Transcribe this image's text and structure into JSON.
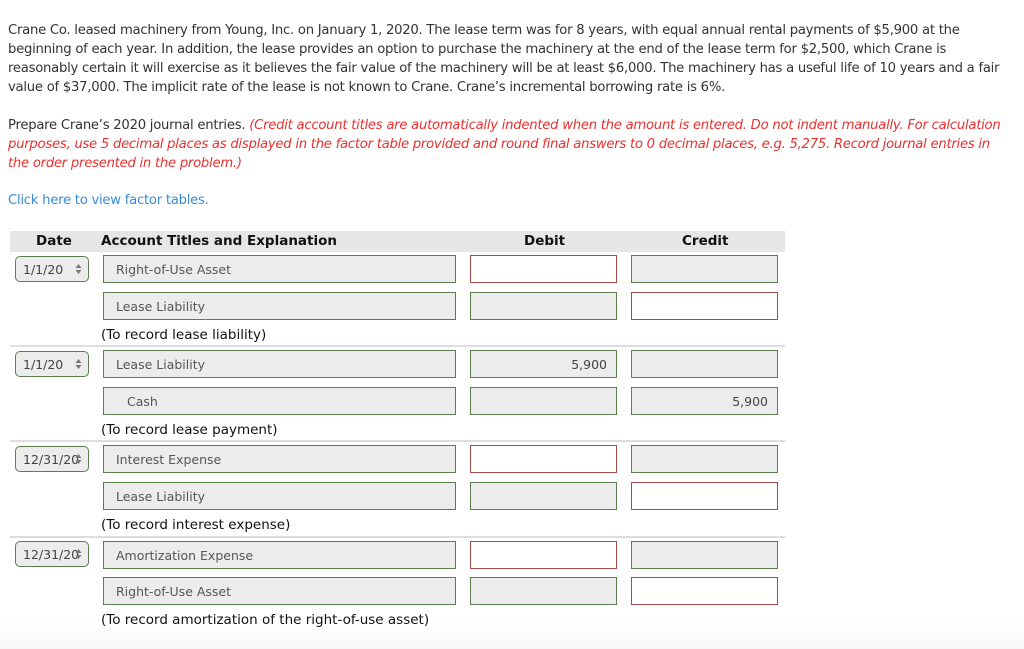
{
  "problem": {
    "text": "Crane Co. leased machinery from Young, Inc. on January 1, 2020. The lease term was for 8 years, with equal annual rental payments of $5,900 at the beginning of each year. In addition, the lease provides an option to purchase the machinery at the end of the lease term for $2,500, which Crane is reasonably certain it will exercise as it believes the fair value of the machinery will be at least $6,000. The machinery has a useful life of 10 years and a fair value of $37,000. The implicit rate of the lease is not known to Crane. Crane’s incremental borrowing rate is 6%."
  },
  "instructions": {
    "prompt": "Prepare Crane’s 2020 journal entries. ",
    "note": "(Credit account titles are automatically indented when the amount is entered. Do not indent manually. For calculation purposes, use 5 decimal places as displayed in the factor table provided and round final answers to 0 decimal places, e.g. 5,275. Record journal entries in the order presented in the problem.)"
  },
  "factor_link": "Click here to view factor tables.",
  "table": {
    "headers": {
      "date": "Date",
      "account": "Account Titles and Explanation",
      "debit": "Debit",
      "credit": "Credit"
    },
    "entries": [
      {
        "date": "1/1/20",
        "lines": [
          {
            "account": "Right-of-Use Asset",
            "debit": "",
            "credit": ""
          },
          {
            "account": "Lease Liability",
            "debit": "",
            "credit": ""
          }
        ],
        "explanation": "(To record lease liability)"
      },
      {
        "date": "1/1/20",
        "lines": [
          {
            "account": "Lease Liability",
            "debit": "5,900",
            "credit": ""
          },
          {
            "account": "Cash",
            "debit": "",
            "credit": "5,900"
          }
        ],
        "explanation": "(To record lease payment)"
      },
      {
        "date": "12/31/20",
        "lines": [
          {
            "account": "Interest Expense",
            "debit": "",
            "credit": ""
          },
          {
            "account": "Lease Liability",
            "debit": "",
            "credit": ""
          }
        ],
        "explanation": "(To record interest expense)"
      },
      {
        "date": "12/31/20",
        "lines": [
          {
            "account": "Amortization Expense",
            "debit": "",
            "credit": ""
          },
          {
            "account": "Right-of-Use Asset",
            "debit": "",
            "credit": ""
          }
        ],
        "explanation": "(To record amortization of the right-of-use asset)"
      }
    ]
  },
  "colors": {
    "correct_border": "#5a7f4e",
    "incorrect_border": "#a84a48",
    "instruction_red": "#e8312f",
    "link_blue": "#3a8bd6"
  }
}
